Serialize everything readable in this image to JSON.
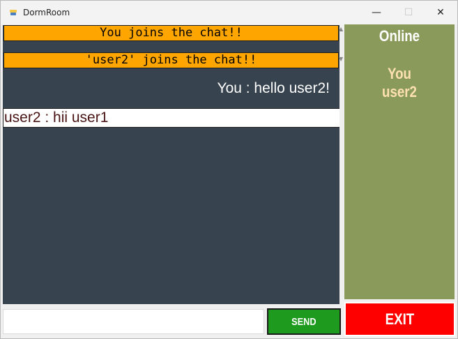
{
  "window": {
    "title": "DormRoom",
    "minimize_glyph": "—",
    "maximize_glyph": "☐",
    "close_glyph": "✕"
  },
  "chat": {
    "messages": [
      {
        "type": "system",
        "text": "You joins the chat!!"
      },
      {
        "type": "system",
        "text": "'user2' joins the chat!!"
      },
      {
        "type": "own",
        "text": "You : hello user2!"
      },
      {
        "type": "other",
        "text": "user2 : hii user1"
      }
    ]
  },
  "online": {
    "title": "Online",
    "users": [
      "You",
      "user2"
    ]
  },
  "composer": {
    "value": "",
    "placeholder": "",
    "send_label": "SEND"
  },
  "exit_label": "EXIT",
  "colors": {
    "system_banner": "#ffa500",
    "chat_background": "#37444f",
    "online_panel": "#8a9a5b",
    "send_button": "#1e9a1e",
    "exit_button": "#ff0000"
  }
}
